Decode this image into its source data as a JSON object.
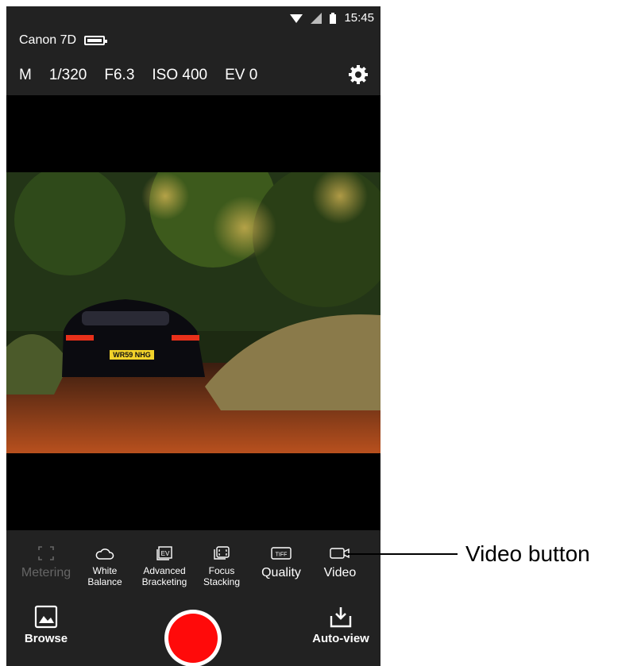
{
  "status_bar": {
    "time": "15:45"
  },
  "camera": {
    "name": "Canon 7D"
  },
  "exposure": {
    "mode": "M",
    "shutter": "1/320",
    "aperture": "F6.3",
    "iso": "ISO 400",
    "ev": "EV 0"
  },
  "toolbar": {
    "metering": "Metering",
    "white_balance_line1": "White",
    "white_balance_line2": "Balance",
    "bracketing_line1": "Advanced",
    "bracketing_line2": "Bracketing",
    "focus_line1": "Focus",
    "focus_line2": "Stacking",
    "quality": "Quality",
    "quality_icon_text": "TIFF",
    "video": "Video",
    "bracketing_icon_text": "EV"
  },
  "bottom": {
    "browse": "Browse",
    "auto_view": "Auto-view"
  },
  "photo": {
    "plate": "WR59 NHG"
  },
  "annotation": {
    "label": "Video button"
  },
  "colors": {
    "shutter": "#ff0a0a",
    "background": "#222222",
    "viewfinder": "#000000"
  }
}
